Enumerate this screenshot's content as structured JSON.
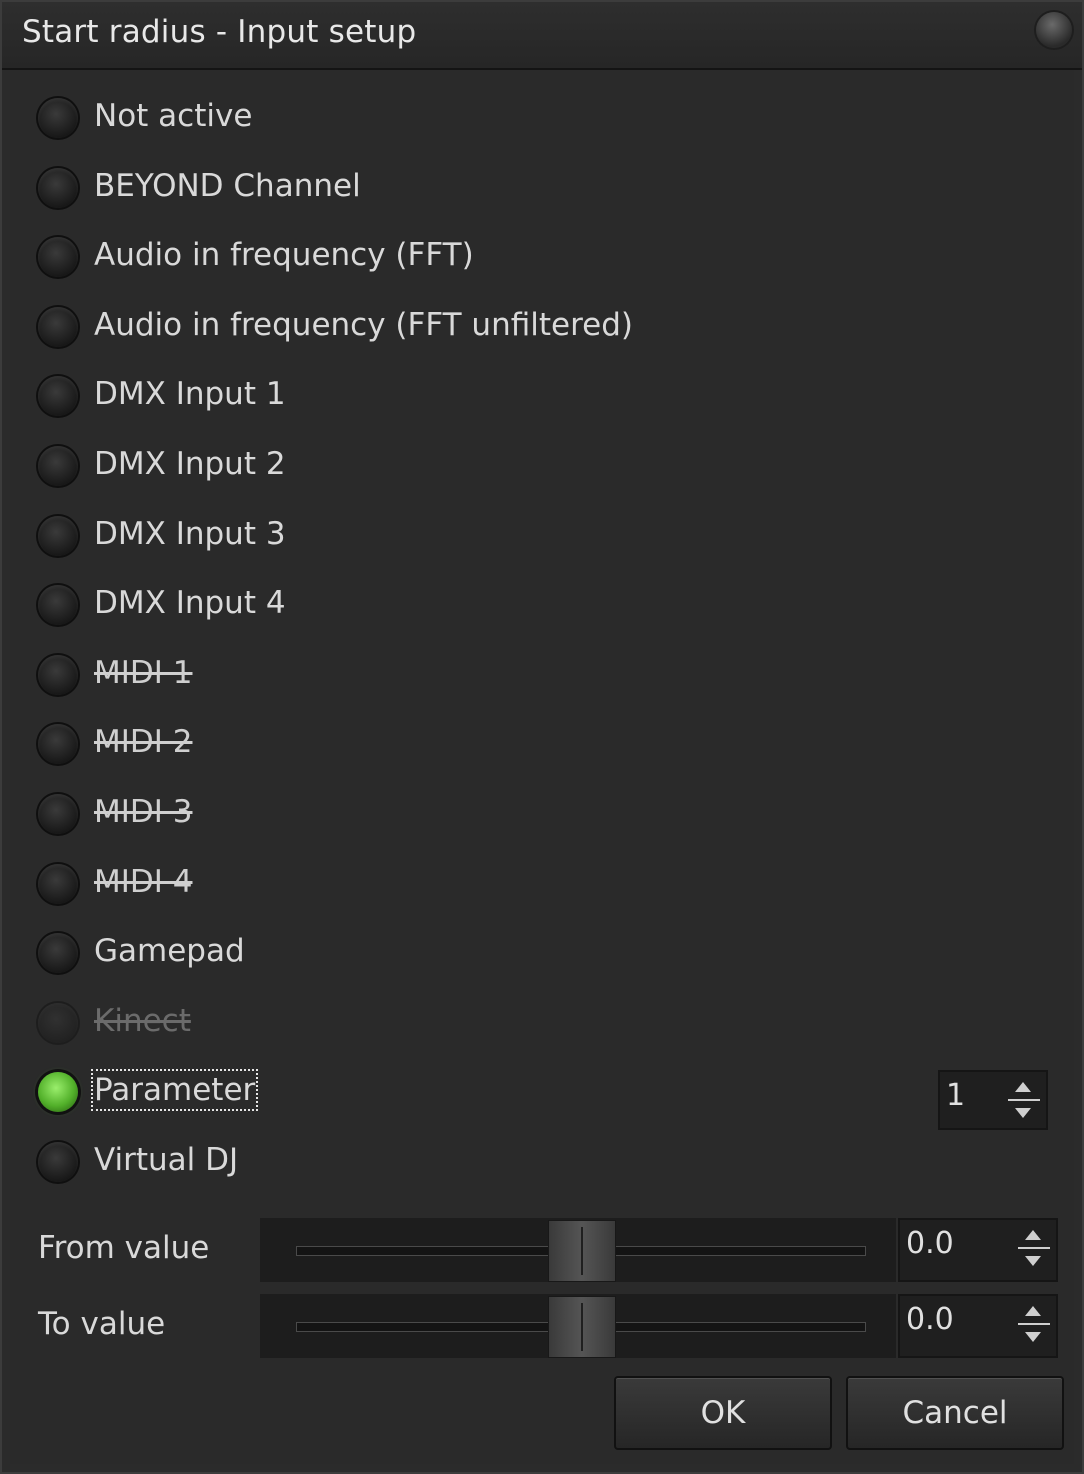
{
  "window": {
    "title": "Start radius - Input setup"
  },
  "options": [
    {
      "label": "Not active",
      "state": "normal"
    },
    {
      "label": "BEYOND Channel",
      "state": "normal"
    },
    {
      "label": "Audio in frequency (FFT)",
      "state": "normal"
    },
    {
      "label": "Audio in frequency (FFT unfiltered)",
      "state": "normal"
    },
    {
      "label": "DMX Input 1",
      "state": "normal"
    },
    {
      "label": "DMX Input 2",
      "state": "normal"
    },
    {
      "label": "DMX Input 3",
      "state": "normal"
    },
    {
      "label": "DMX Input 4",
      "state": "normal"
    },
    {
      "label": "MIDI 1",
      "state": "struck"
    },
    {
      "label": "MIDI 2",
      "state": "struck"
    },
    {
      "label": "MIDI 3",
      "state": "struck"
    },
    {
      "label": "MIDI 4",
      "state": "struck"
    },
    {
      "label": "Gamepad",
      "state": "normal"
    },
    {
      "label": "Kinect",
      "state": "disabled"
    },
    {
      "label": "Parameter",
      "state": "selected"
    },
    {
      "label": "Virtual DJ",
      "state": "normal"
    }
  ],
  "parameter_index": "1",
  "from": {
    "label": "From value",
    "value": "0.0",
    "position": 0.5
  },
  "to": {
    "label": "To value",
    "value": "0.0",
    "position": 0.5
  },
  "buttons": {
    "ok": "OK",
    "cancel": "Cancel"
  },
  "colors": {
    "selected_radio": "#5ec832",
    "background": "#2a2a2a"
  }
}
